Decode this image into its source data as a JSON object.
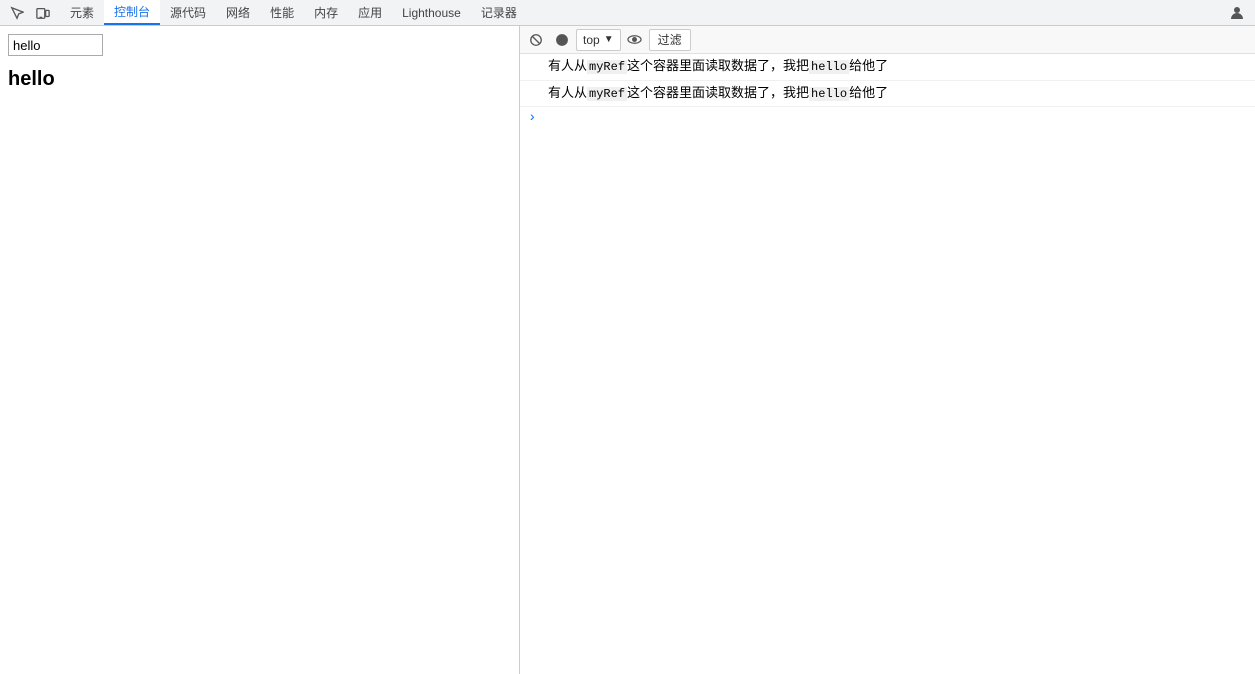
{
  "tabs": {
    "items": [
      {
        "label": "元素",
        "active": false
      },
      {
        "label": "控制台",
        "active": true
      },
      {
        "label": "源代码",
        "active": false
      },
      {
        "label": "网络",
        "active": false
      },
      {
        "label": "性能",
        "active": false
      },
      {
        "label": "内存",
        "active": false
      },
      {
        "label": "应用",
        "active": false
      },
      {
        "label": "Lighthouse",
        "active": false
      },
      {
        "label": "记录器",
        "active": false
      }
    ]
  },
  "console_toolbar": {
    "top_label": "top",
    "chevron": "▼",
    "filter_label": "过滤"
  },
  "webpage": {
    "input_value": "hello",
    "hello_text": "hello"
  },
  "console_lines": [
    {
      "text_parts": [
        {
          "type": "text",
          "content": "有人从"
        },
        {
          "type": "code",
          "content": "myRef"
        },
        {
          "type": "text",
          "content": "这个容器里面读取数据了，我把"
        },
        {
          "type": "code",
          "content": "hello"
        },
        {
          "type": "text",
          "content": "给他了"
        }
      ]
    },
    {
      "text_parts": [
        {
          "type": "text",
          "content": "有人从"
        },
        {
          "type": "code",
          "content": "myRef"
        },
        {
          "type": "text",
          "content": "这个容器里面读取数据了，我把"
        },
        {
          "type": "code",
          "content": "hello"
        },
        {
          "type": "text",
          "content": "给他了"
        }
      ]
    }
  ]
}
